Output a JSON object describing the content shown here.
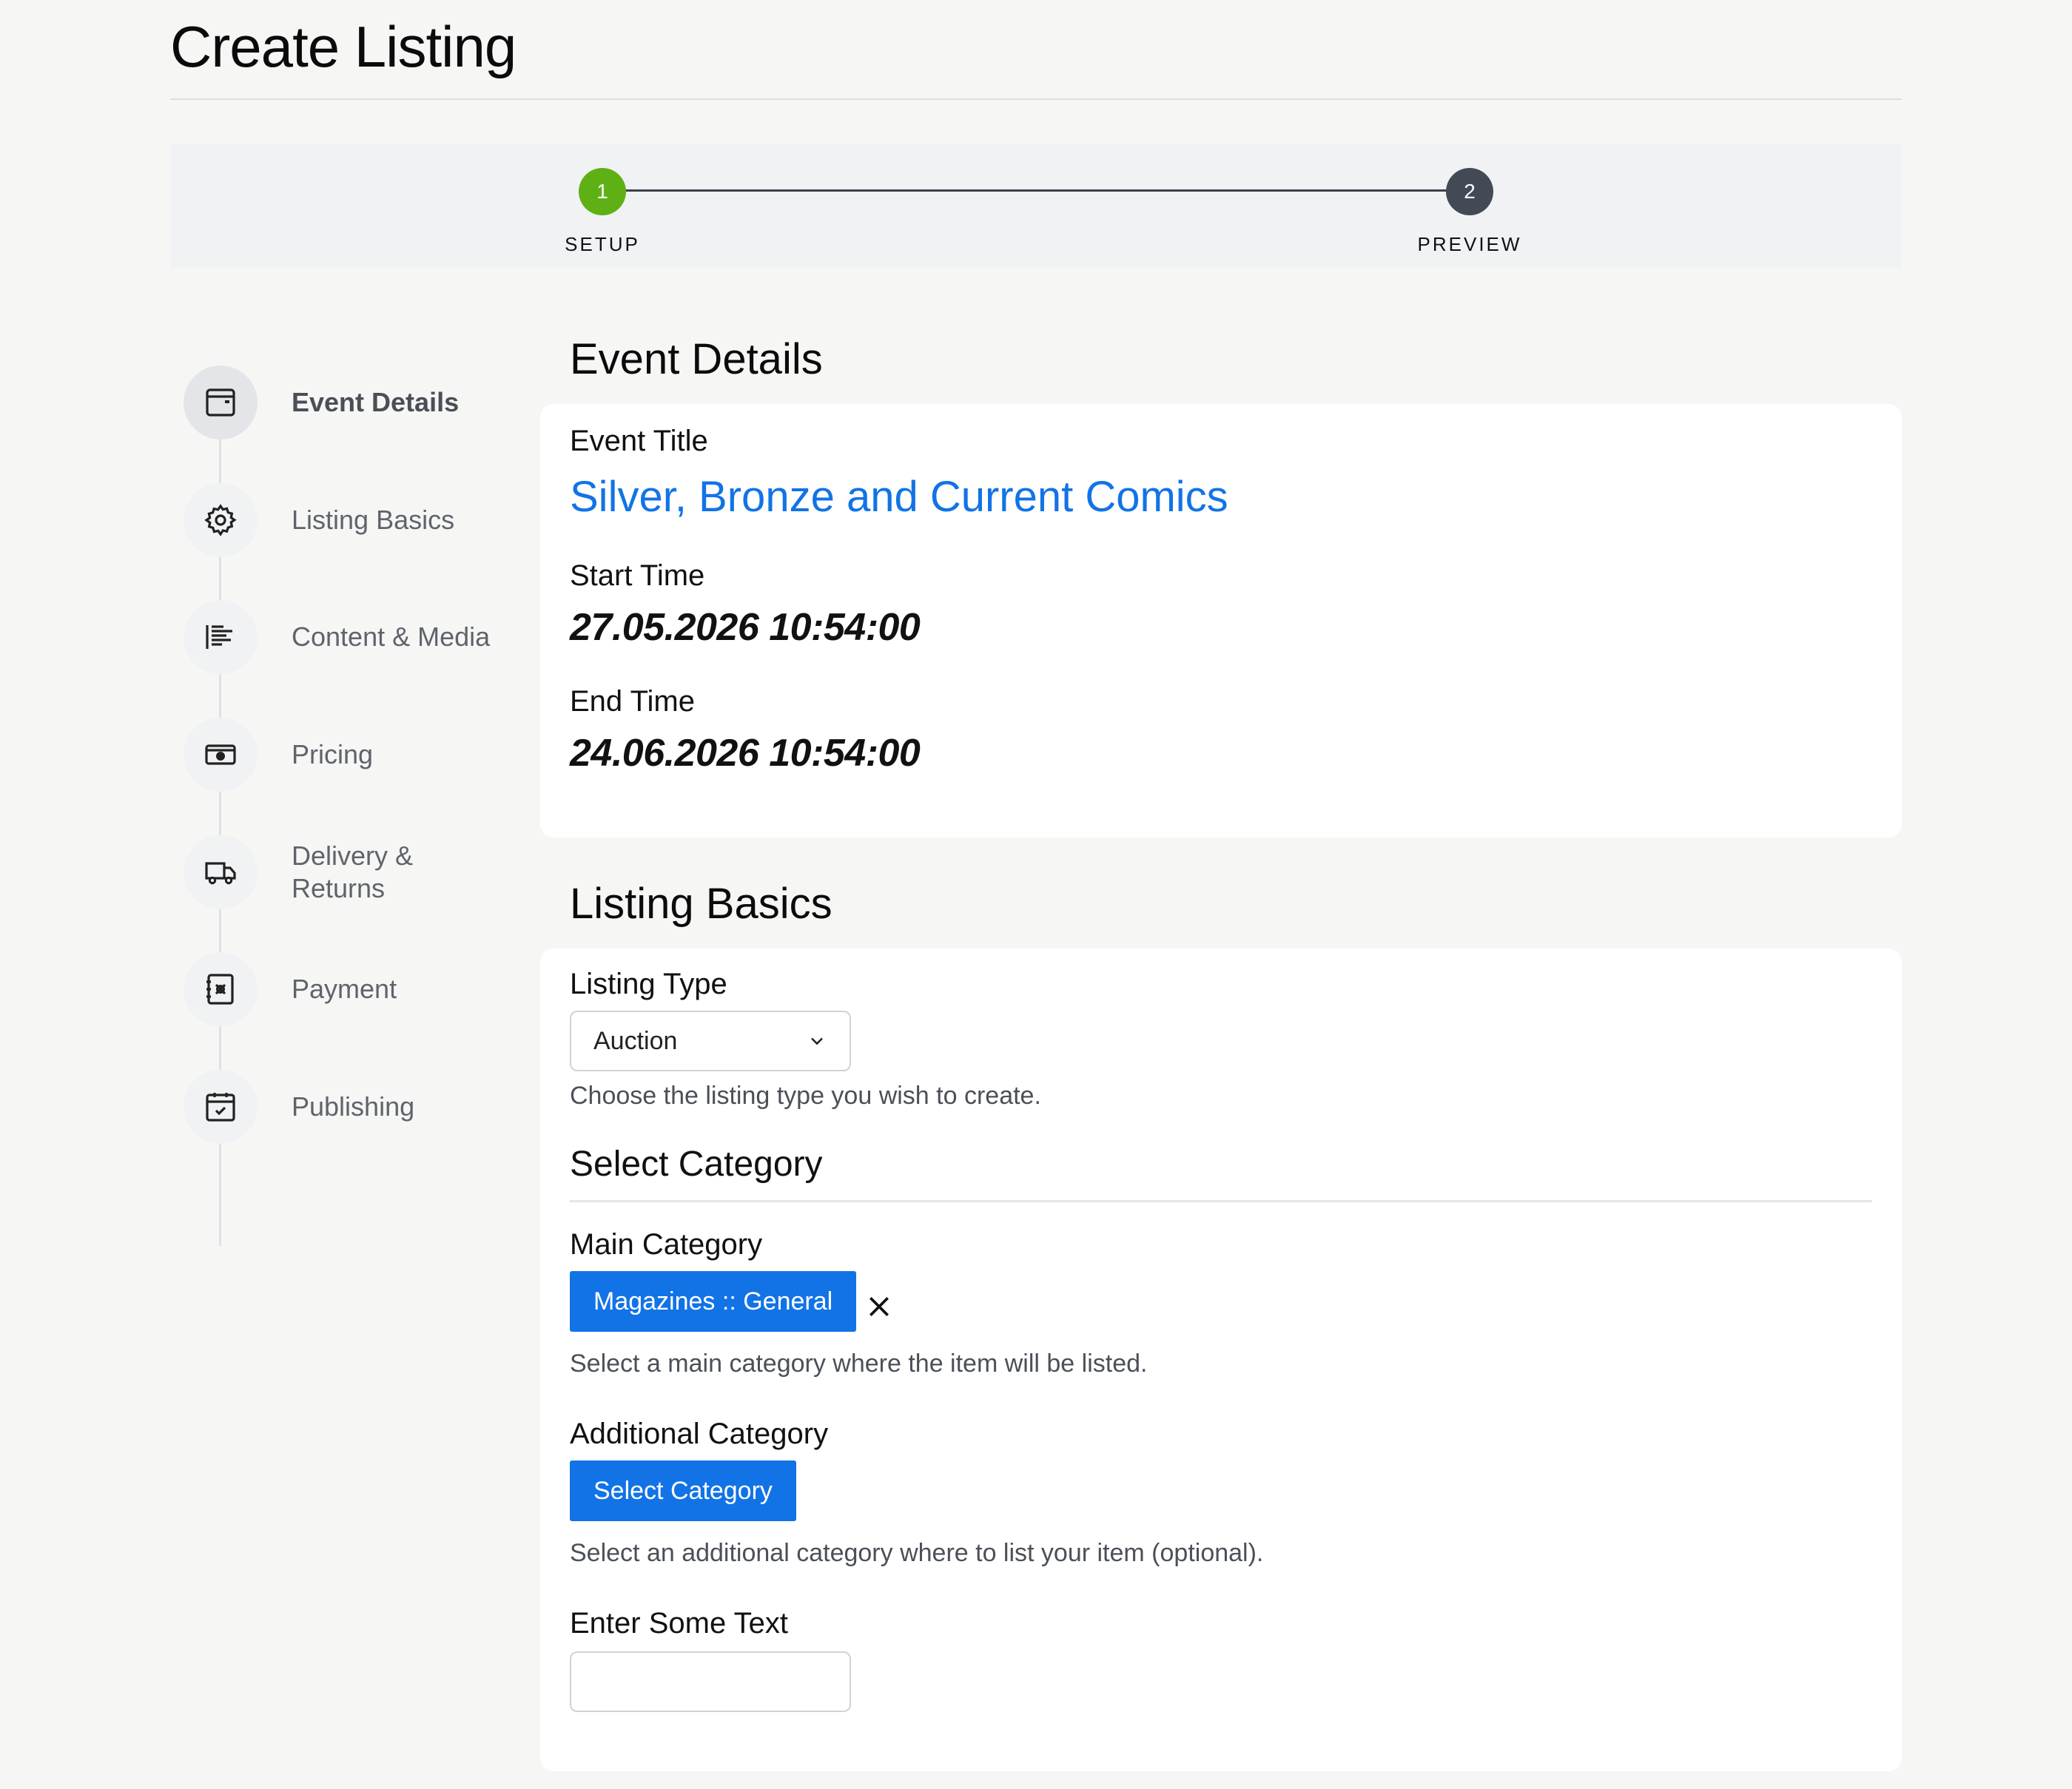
{
  "page": {
    "title": "Create Listing"
  },
  "stepper": {
    "steps": [
      {
        "number": "1",
        "label": "SETUP",
        "state": "done",
        "color": "#5fb015"
      },
      {
        "number": "2",
        "label": "PREVIEW",
        "state": "pending",
        "color": "#434a56"
      }
    ]
  },
  "sidebar": {
    "items": [
      {
        "label": "Event Details",
        "icon": "calendar-card-icon",
        "active": true
      },
      {
        "label": "Listing Basics",
        "icon": "gear-icon",
        "active": false
      },
      {
        "label": "Content & Media",
        "icon": "text-lines-icon",
        "active": false
      },
      {
        "label": "Pricing",
        "icon": "cash-icon",
        "active": false
      },
      {
        "label": "Delivery & Returns",
        "icon": "truck-icon",
        "active": false
      },
      {
        "label": "Payment",
        "icon": "payment-book-icon",
        "active": false
      },
      {
        "label": "Publishing",
        "icon": "calendar-check-icon",
        "active": false
      }
    ]
  },
  "event_details": {
    "heading": "Event Details",
    "title_label": "Event Title",
    "title_value": "Silver, Bronze and Current Comics",
    "start_label": "Start Time",
    "start_value": "27.05.2026 10:54:00",
    "end_label": "End Time",
    "end_value": "24.06.2026 10:54:00"
  },
  "listing_basics": {
    "heading": "Listing Basics",
    "type_label": "Listing Type",
    "type_value": "Auction",
    "type_help": "Choose the listing type you wish to create.",
    "category_heading": "Select Category",
    "main_category_label": "Main Category",
    "main_category_value": "Magazines :: General",
    "main_category_help": "Select a main category where the item will be listed.",
    "additional_category_label": "Additional Category",
    "additional_category_button": "Select Category",
    "additional_category_help": "Select an additional category where to list your item (optional).",
    "text_label": "Enter Some Text",
    "text_value": ""
  },
  "colors": {
    "accent": "#1273e6",
    "success": "#5fb015",
    "background": "#f6f6f5"
  }
}
